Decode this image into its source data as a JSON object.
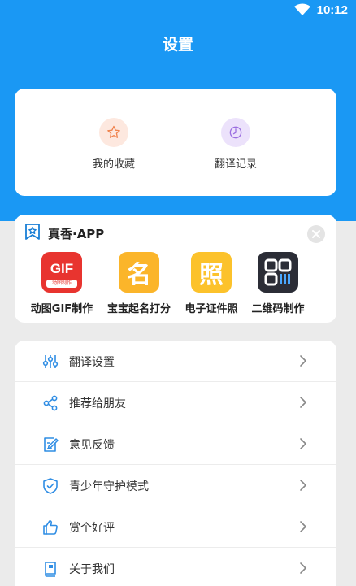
{
  "status_bar": {
    "time": "10:12"
  },
  "header": {
    "title": "设置"
  },
  "quick_actions": [
    {
      "label": "我的收藏",
      "icon": "star-icon",
      "color": "#f0834e"
    },
    {
      "label": "翻译记录",
      "icon": "clock-icon",
      "color": "#9b6fe0"
    }
  ],
  "apps_section": {
    "title": "真香·APP",
    "apps": [
      {
        "name": "动图GIF制作",
        "icon_text": "GIF",
        "icon_subtext": "动图制作",
        "color": "#e8342f"
      },
      {
        "name": "宝宝起名打分",
        "icon_text": "名",
        "color": "#fbb52a"
      },
      {
        "name": "电子证件照",
        "icon_text": "照",
        "color": "#fcc22b"
      },
      {
        "name": "二维码制作",
        "icon": "qr-code-icon",
        "color": "#2b2d36"
      }
    ]
  },
  "menu": [
    {
      "label": "翻译设置",
      "icon": "sliders-icon"
    },
    {
      "label": "推荐给朋友",
      "icon": "share-icon"
    },
    {
      "label": "意见反馈",
      "icon": "edit-feedback-icon"
    },
    {
      "label": "青少年守护模式",
      "icon": "shield-icon"
    },
    {
      "label": "赏个好评",
      "icon": "thumbs-up-icon"
    },
    {
      "label": "关于我们",
      "icon": "book-icon"
    }
  ],
  "colors": {
    "primary": "#1a98f4",
    "icon_blue": "#2f8de4"
  }
}
